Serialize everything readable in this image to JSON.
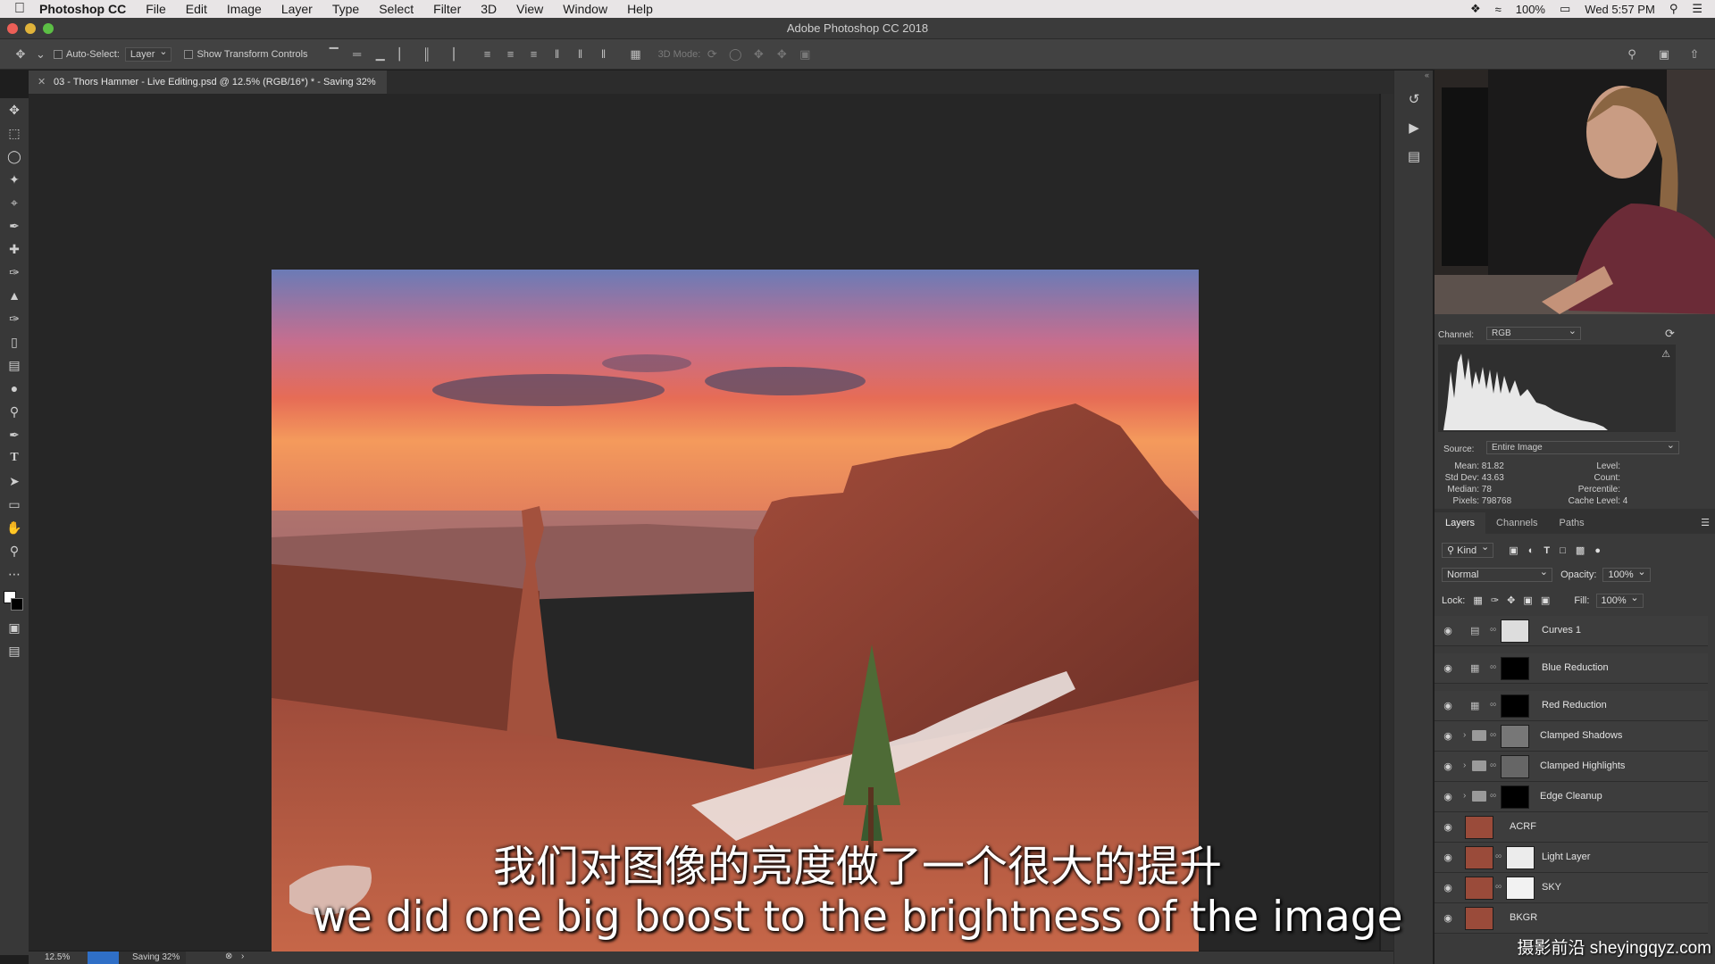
{
  "menubar": {
    "app_name": "Photoshop CC",
    "items": [
      "File",
      "Edit",
      "Image",
      "Layer",
      "Type",
      "Select",
      "Filter",
      "3D",
      "View",
      "Window",
      "Help"
    ],
    "battery": "100%",
    "clock": "Wed 5:57 PM"
  },
  "window": {
    "title": "Adobe Photoshop CC 2018"
  },
  "options_bar": {
    "auto_select_label": "Auto-Select:",
    "auto_select_value": "Layer",
    "transform_label": "Show Transform Controls",
    "mode_3d_label": "3D Mode:"
  },
  "document": {
    "tab_title": "03 - Thors Hammer - Live Editing.psd @ 12.5% (RGB/16*) * - Saving 32%"
  },
  "status": {
    "zoom": "12.5%",
    "saving_text": "Saving 32%",
    "saving_progress": 0.32
  },
  "histogram": {
    "channel_label": "Channel:",
    "channel_value": "RGB",
    "source_label": "Source:",
    "source_value": "Entire Image",
    "stats_left": [
      {
        "label": "Mean:",
        "value": "81.82"
      },
      {
        "label": "Std Dev:",
        "value": "43.63"
      },
      {
        "label": "Median:",
        "value": "78"
      },
      {
        "label": "Pixels:",
        "value": "798768"
      }
    ],
    "stats_right": [
      {
        "label": "Level:",
        "value": ""
      },
      {
        "label": "Count:",
        "value": ""
      },
      {
        "label": "Percentile:",
        "value": ""
      },
      {
        "label": "Cache Level:",
        "value": "4"
      }
    ]
  },
  "layers_panel": {
    "tabs": [
      "Layers",
      "Channels",
      "Paths"
    ],
    "filter_label": "Kind",
    "blend_mode": "Normal",
    "opacity_label": "Opacity:",
    "opacity_value": "100%",
    "lock_label": "Lock:",
    "fill_label": "Fill:",
    "fill_value": "100%",
    "layers": [
      {
        "name": "Curves 1",
        "kind": "adjustment"
      },
      {
        "name": "Blue Reduction",
        "kind": "adjustment"
      },
      {
        "name": "Red Reduction",
        "kind": "adjustment"
      },
      {
        "name": "Clamped Shadows",
        "kind": "group"
      },
      {
        "name": "Clamped Highlights",
        "kind": "group"
      },
      {
        "name": "Edge Cleanup",
        "kind": "group"
      },
      {
        "name": "ACRF",
        "kind": "pixel"
      },
      {
        "name": "Light Layer",
        "kind": "pixel"
      },
      {
        "name": "SKY",
        "kind": "pixel"
      },
      {
        "name": "BKGR",
        "kind": "pixel"
      }
    ]
  },
  "subtitles": {
    "zh": "我们对图像的亮度做了一个很大的提升",
    "en": "we did one big boost to the brightness of the image"
  },
  "watermark": "摄影前沿 sheyingqyz.com"
}
